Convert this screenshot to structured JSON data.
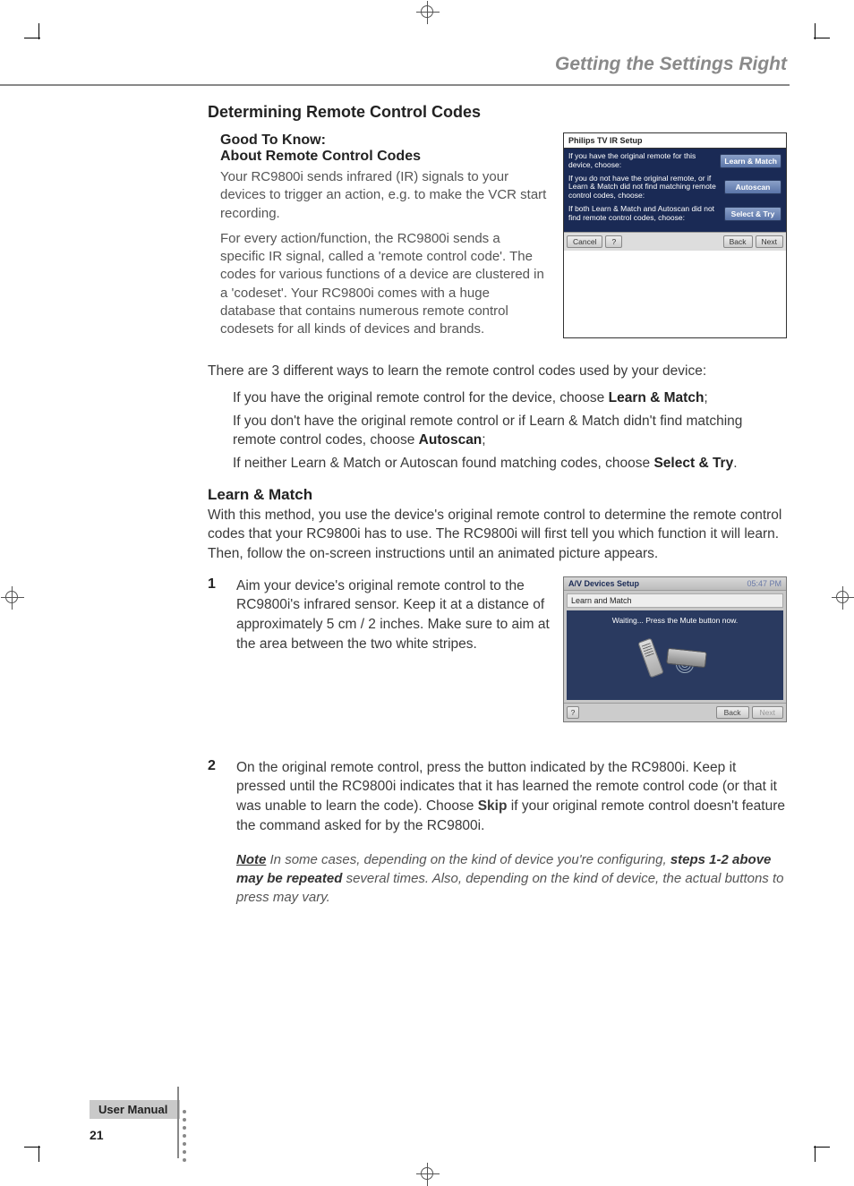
{
  "header": {
    "chapter": "Getting the Settings Right"
  },
  "section": {
    "title": "Determining Remote Control Codes"
  },
  "gtk": {
    "line1": "Good To Know:",
    "line2": "About Remote Control Codes",
    "para1": "Your RC9800i sends infrared (IR) signals to your devices to trigger an action, e.g. to make the VCR start recording.",
    "para2": "For every action/function, the RC9800i sends a specific IR signal, called a 'remote control code'. The codes for various functions of a device are clustered in a 'codeset'. Your RC9800i comes with a huge database that contains numerous remote control codesets for all kinds of devices and brands."
  },
  "ss1": {
    "title": "Philips TV IR Setup",
    "rows": [
      {
        "text": "If you have the original remote for this device, choose:",
        "btn": "Learn & Match"
      },
      {
        "text": "If you do not have the original remote, or if Learn & Match did not find matching remote control codes, choose:",
        "btn": "Autoscan"
      },
      {
        "text": "If both Learn & Match and Autoscan did not find remote control codes, choose:",
        "btn": "Select & Try"
      }
    ],
    "footer": {
      "cancel": "Cancel",
      "help": "?",
      "back": "Back",
      "next": "Next"
    }
  },
  "intro": {
    "lead": "There are 3 different ways to learn the remote control codes used by your device:",
    "bullets": [
      {
        "pre": "If you have the original remote control for the device, choose",
        "bold": "Learn & Match",
        "post": ";"
      },
      {
        "pre": "If you don't have the original remote control or if Learn & Match didn't find matching remote control codes, choose",
        "bold": "Autoscan",
        "post": ";"
      },
      {
        "pre": "If neither Learn & Match or Autoscan found matching codes, choose",
        "bold": "Select & Try",
        "post": "."
      }
    ]
  },
  "learn": {
    "title": "Learn & Match",
    "body": "With this method, you use the device's original remote control to determine the remote control codes that your RC9800i has to use. The RC9800i will first tell you which function it will learn. Then, follow the on-screen instructions until an animated picture appears."
  },
  "steps": [
    {
      "num": "1",
      "text": "Aim your device's original remote control to the RC9800i's infrared sensor. Keep it at a distance of approximately 5 cm / 2 inches. Make sure to aim at the area between the two white stripes."
    },
    {
      "num": "2",
      "pre": "On the original remote control, press the button indicated by the RC9800i. Keep it pressed until the RC9800i indicates that it has learned the remote control code (or that it was unable to learn the code). Choose",
      "bold": "Skip",
      "post": "if your original remote control doesn't feature the command asked for by the RC9800i."
    }
  ],
  "ss2": {
    "title": "A/V Devices Setup",
    "time": "05:47 PM",
    "subtitle": "Learn and Match",
    "waiting": "Waiting... Press the Mute button now.",
    "footer": {
      "help": "?",
      "back": "Back",
      "next": "Next"
    }
  },
  "note": {
    "lead": "Note",
    "pre": " In some cases, depending on the kind of device you're configuring, ",
    "bold": "steps 1-2 above may be repeated",
    "post": " several times. Also, depending on the kind of device, the actual buttons to press may vary."
  },
  "footer": {
    "label": "User Manual",
    "page": "21"
  }
}
